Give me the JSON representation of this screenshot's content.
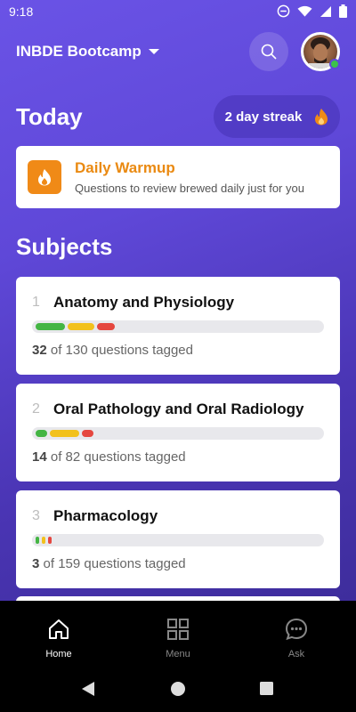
{
  "status": {
    "time": "9:18"
  },
  "header": {
    "workspace": "INBDE Bootcamp"
  },
  "today": {
    "title": "Today",
    "streak_label": "2 day streak",
    "warmup": {
      "title": "Daily Warmup",
      "subtitle": "Questions to review brewed daily just for you"
    }
  },
  "subjects": {
    "title": "Subjects",
    "items": [
      {
        "index": "1",
        "name": "Anatomy and Physiology",
        "tagged": "32",
        "rest": "of 130 questions tagged",
        "progress": {
          "green": 0.1,
          "yellow": 0.09,
          "red": 0.06
        }
      },
      {
        "index": "2",
        "name": "Oral Pathology and Oral Radiology",
        "tagged": "14",
        "rest": "of 82 questions tagged",
        "progress": {
          "green": 0.04,
          "yellow": 0.1,
          "red": 0.04
        }
      },
      {
        "index": "3",
        "name": "Pharmacology",
        "tagged": "3",
        "rest": "of 159 questions tagged",
        "progress": {
          "green": 0.01,
          "yellow": 0.003,
          "red": 0.01
        }
      }
    ]
  },
  "nav": {
    "home": "Home",
    "menu": "Menu",
    "ask": "Ask"
  },
  "colors": {
    "accent": "#6a53e6",
    "warmup": "#f08a17",
    "green": "#44b544",
    "yellow": "#f2c11c",
    "red": "#e5473f"
  }
}
